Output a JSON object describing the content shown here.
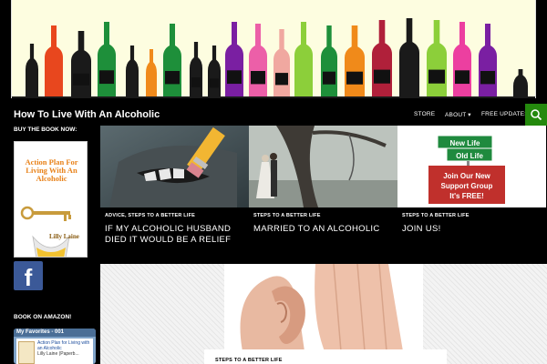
{
  "header": {
    "site_title": "How To Live With An Alcoholic",
    "nav": [
      "STORE",
      "ABOUT ▾",
      "FREE UPDATES"
    ],
    "search_icon": "search-icon"
  },
  "sidebar": {
    "buy_title": "BUY THE BOOK NOW:",
    "book": {
      "title": "Action Plan For Living With An Alcoholic",
      "author": "Lilly Laine"
    },
    "social_icon": "facebook-icon",
    "amazon_title": "BOOK ON AMAZON!",
    "amazon_widget": {
      "header": "My Favorites - 001",
      "item": "Action Plan for Living with an Alcoholic",
      "author": "Lilly Laine (Paperb..."
    }
  },
  "featured": [
    {
      "category": "ADVICE, STEPS TO A BETTER LIFE",
      "title": "IF MY ALCOHOLIC HUSBAND DIED IT WOULD BE A RELIEF"
    },
    {
      "category": "STEPS TO A BETTER LIFE",
      "title": "MARRIED TO AN ALCOHOLIC"
    },
    {
      "category": "STEPS TO A BETTER LIFE",
      "title": "JOIN US!"
    }
  ],
  "join_sign": {
    "new_life": "New Life",
    "old_life": "Old Life",
    "message": "Join Our New Support Group It's FREE!"
  },
  "main_post": {
    "category": "STEPS TO A BETTER LIFE"
  },
  "colors": {
    "accent": "#24890d",
    "background": "#000000",
    "banner": "#fdfde0"
  }
}
